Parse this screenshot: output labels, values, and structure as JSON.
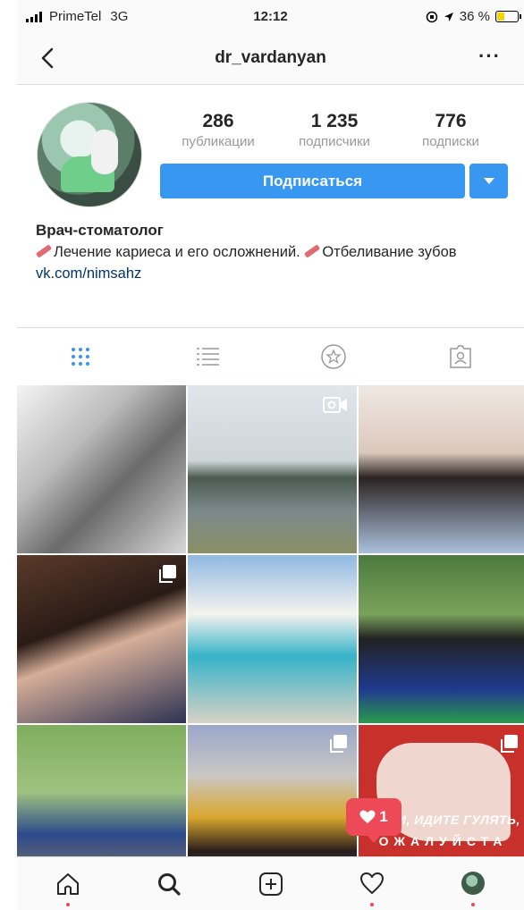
{
  "status_bar": {
    "carrier": "PrimeTel",
    "network": "3G",
    "time": "12:12",
    "battery": "36 %"
  },
  "nav": {
    "title": "dr_vardanyan",
    "more": "···"
  },
  "profile": {
    "stats": [
      {
        "value": "286",
        "label": "публикации"
      },
      {
        "value": "1 235",
        "label": "подписчики"
      },
      {
        "value": "776",
        "label": "подписки"
      }
    ],
    "follow_label": "Подписаться",
    "bio_name": "Врач-стоматолог",
    "bio_text_1": "Лечение кариеса и его осложнений.",
    "bio_text_2": "Отбеливание",
    "bio_text_3": "зубов",
    "bio_link": "vk.com/nimsahz"
  },
  "tabs": [
    "grid-icon",
    "list-icon",
    "tagged-star-icon",
    "tagged-person-icon"
  ],
  "posts": [
    {
      "type": "photo"
    },
    {
      "type": "video"
    },
    {
      "type": "photo"
    },
    {
      "type": "carousel"
    },
    {
      "type": "photo"
    },
    {
      "type": "photo"
    },
    {
      "type": "photo"
    },
    {
      "type": "carousel"
    },
    {
      "type": "carousel",
      "caption_1": "РИЩИ, ИДИТЕ ГУЛЯТЬ,",
      "caption_2": "ОЖАЛУЙСТА"
    }
  ],
  "notification": {
    "likes": "1"
  },
  "bottom_nav": [
    "home-icon",
    "search-icon",
    "add-post-icon",
    "activity-heart-icon",
    "profile-avatar"
  ],
  "colors": {
    "accent": "#3897f0",
    "notification": "#ed4956"
  }
}
